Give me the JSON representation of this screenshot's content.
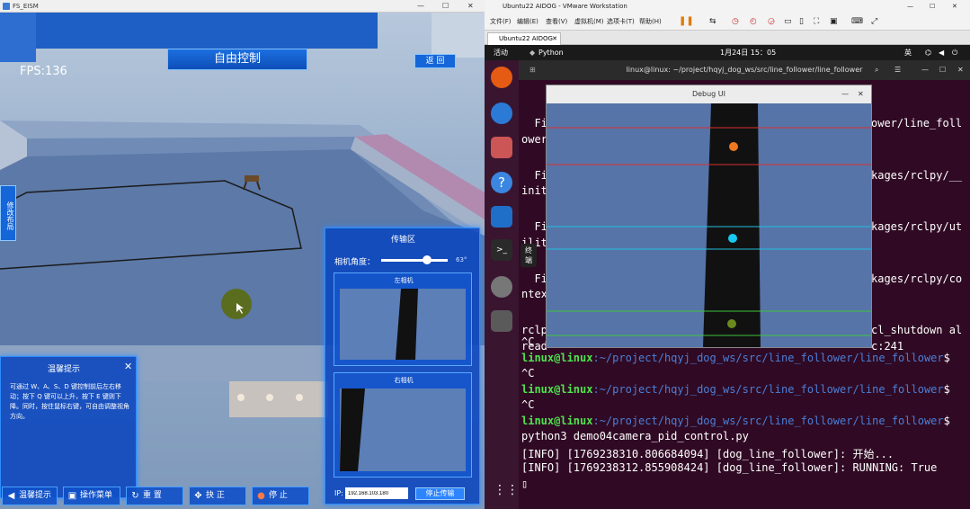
{
  "left_window": {
    "title": "FS_EISM",
    "fps": "FPS:136",
    "hud_title": "自由控制",
    "back_label": "返 回",
    "side_tab": "修改布局"
  },
  "transfer_panel": {
    "title": "传输区",
    "angle_label": "相机角度：",
    "angle_value": "63°",
    "left_cam": "左相机",
    "right_cam": "右相机",
    "ip_label": "IP:",
    "ip_value": "192.168.103.180",
    "stop_label": "停止传输"
  },
  "tips": {
    "title": "温馨提示",
    "text": "可通过 W、A、S、D 键控制前后左右移动；按下 Q 键可以上升，按下 E 键则下降。同时，按住鼠标右键，可自由调整视角方向。"
  },
  "toolbar": {
    "tips": "温馨提示",
    "menu": "操作菜单",
    "reset": "重 置",
    "grab": "抉 正",
    "stop": "停 止"
  },
  "vm": {
    "title": "Ubuntu22 AIDOG - VMware Workstation",
    "menus": [
      "文件(F)",
      "编辑(E)",
      "查看(V)",
      "虚拟机(M)",
      "选项卡(T)",
      "帮助(H)"
    ],
    "tab": "Ubuntu22 AIDOG",
    "activities": "活动",
    "app": "Python",
    "clock": "1月24日  15：05",
    "lang": "英",
    "dock_tooltip": "终端"
  },
  "terminal": {
    "title": "linux@linux: ~/project/hqyj_dog_ws/src/line_follower/line_follower",
    "lines": [
      {
        "pre": "  Fi",
        "post": "ower/line_foll"
      },
      {
        "pre": "ower",
        "post": ""
      },
      {
        "pre": "  Fi",
        "post": "kages/rclpy/__"
      },
      {
        "pre": "init",
        "post": ""
      },
      {
        "pre": "  Fi",
        "post": "kages/rclpy/ut"
      },
      {
        "pre": "ilit",
        "post": ""
      },
      {
        "pre": "  Fi",
        "post": "kages/rclpy/co"
      },
      {
        "pre": "ntex",
        "post": ""
      },
      {
        "pre": "rclp",
        "post": "cl_shutdown al"
      },
      {
        "pre": "read",
        "post": "c:241"
      }
    ],
    "prompt_user": "linux@linux",
    "prompt_path": ":~/project/hqyj_dog_ws/src/line_follower/line_follower",
    "ctrl_c": "^C",
    "cmd": "python3 demo04camera_pid_control.py",
    "info1": "[INFO] [1769238310.806684094] [dog_line_follower]: 开始...",
    "info2": "[INFO] [1769238312.855908424] [dog_line_follower]: RUNNING: True"
  },
  "debug_ui": {
    "title": "Debug UI"
  },
  "colors": {
    "panel": "#0d4fb8",
    "term_bg": "#300a24",
    "prompt": "#4ee44e",
    "path": "#4a7fd8"
  }
}
